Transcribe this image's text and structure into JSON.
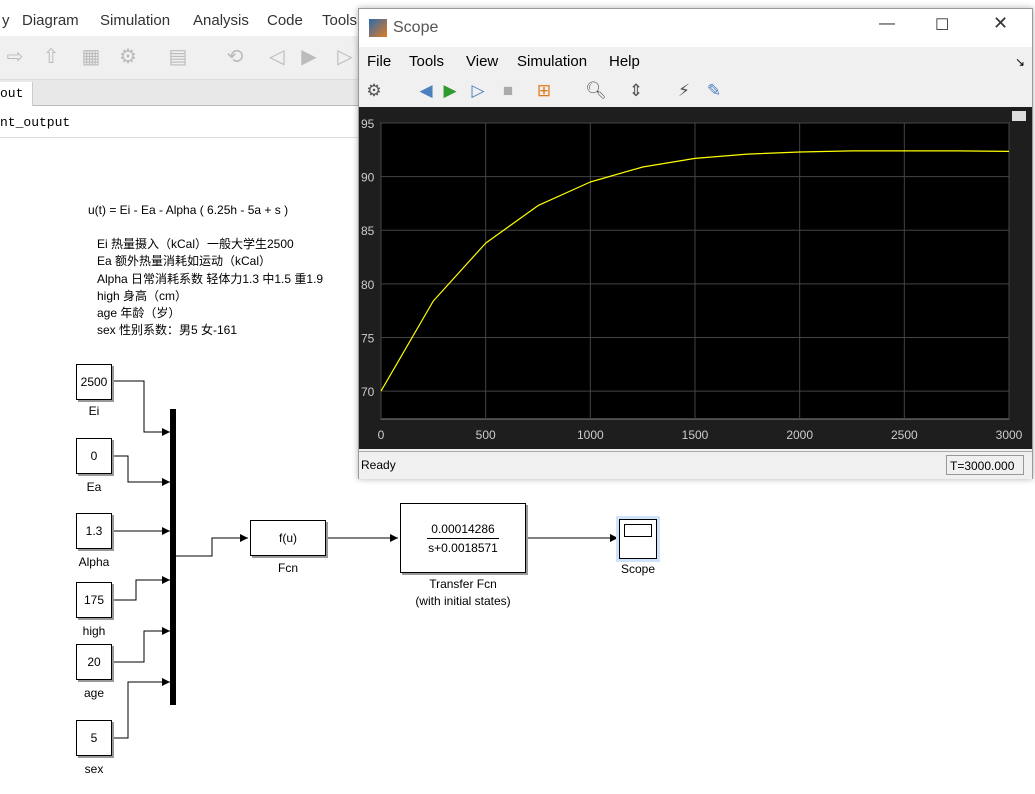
{
  "editor": {
    "menu": [
      "y",
      "Diagram",
      "Simulation",
      "Analysis",
      "Code",
      "Tools"
    ],
    "tab_label": "out",
    "address": "nt_output",
    "notes": [
      "u(t) = Ei - Ea - Alpha ( 6.25h - 5a + s )",
      "Ei 热量摄入（kCal）一般大学生2500",
      "Ea 额外热量消耗如运动（kCal）",
      "Alpha 日常消耗系数 轻体力1.3 中1.5 重1.9",
      "high 身高（cm）",
      "age 年龄（岁）",
      "sex 性别系数：男5 女-161"
    ],
    "constants": [
      {
        "value": "2500",
        "label": "Ei"
      },
      {
        "value": "0",
        "label": "Ea"
      },
      {
        "value": "1.3",
        "label": "Alpha"
      },
      {
        "value": "175",
        "label": "high"
      },
      {
        "value": "20",
        "label": "age"
      },
      {
        "value": "5",
        "label": "sex"
      }
    ],
    "fcn": {
      "text": "f(u)",
      "label": "Fcn"
    },
    "tf": {
      "num": "0.00014286",
      "den": "s+0.0018571",
      "label1": "Transfer Fcn",
      "label2": "(with initial states)"
    },
    "scope_label": "Scope"
  },
  "scope": {
    "title": "Scope",
    "menu": [
      "File",
      "Tools",
      "View",
      "Simulation",
      "Help"
    ],
    "status": "Ready",
    "time": "T=3000.000",
    "toolbar_icons": [
      "gear-icon",
      "step-back-icon",
      "run-icon",
      "step-forward-icon",
      "stop-icon",
      "signal-select-icon",
      "zoom-icon",
      "autoscale-icon",
      "trigger-icon",
      "measure-icon"
    ]
  },
  "chart_data": {
    "type": "line",
    "xlim": [
      0,
      3000
    ],
    "ylim": [
      67.4,
      95
    ],
    "xticks": [
      "0",
      "500",
      "1000",
      "1500",
      "2000",
      "2500",
      "3000"
    ],
    "yticks": [
      "70",
      "75",
      "80",
      "85",
      "90",
      "95"
    ],
    "grid": true,
    "line_color": "#ffff00",
    "background": "#000000",
    "x": [
      0,
      250,
      500,
      750,
      1000,
      1250,
      1500,
      1750,
      2000,
      2250,
      2500,
      2750,
      3000
    ],
    "y": [
      70.0,
      78.4,
      83.8,
      87.3,
      89.5,
      90.9,
      91.7,
      92.1,
      92.3,
      92.4,
      92.4,
      92.4,
      92.35
    ]
  }
}
